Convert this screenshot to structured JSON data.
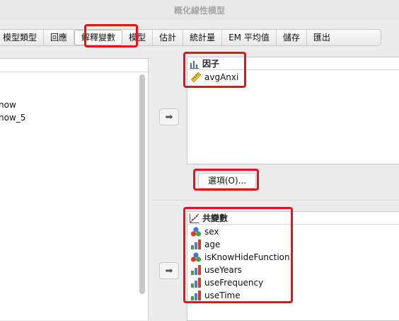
{
  "window": {
    "title": "概化線性模型"
  },
  "tabs": [
    {
      "label": "模型類型"
    },
    {
      "label": "回應"
    },
    {
      "label": "解釋變數",
      "active": true
    },
    {
      "label": "模型"
    },
    {
      "label": "估計"
    },
    {
      "label": "統計量"
    },
    {
      "label": "EM 平均值"
    },
    {
      "label": "儲存"
    },
    {
      "label": "匯出"
    }
  ],
  "variables_list": {
    "items": [
      {
        "label": "now"
      },
      {
        "label": "now_5"
      }
    ]
  },
  "factors": {
    "header": "因子",
    "icon": "factor-icon",
    "items": [
      {
        "label": "avgAnxi",
        "icon": "scale-ruler-icon"
      }
    ]
  },
  "options_button": {
    "label": "選項(O)..."
  },
  "covariates": {
    "header": "共變數",
    "icon": "covariate-icon",
    "items": [
      {
        "label": "sex",
        "icon": "nominal-icon"
      },
      {
        "label": "age",
        "icon": "ordinal-icon"
      },
      {
        "label": "isKnowHideFunction",
        "icon": "nominal-icon"
      },
      {
        "label": "useYears",
        "icon": "ordinal-icon"
      },
      {
        "label": "useFrequency",
        "icon": "ordinal-icon"
      },
      {
        "label": "useTime",
        "icon": "ordinal-icon"
      }
    ]
  },
  "colors": {
    "highlight": "#e8101a"
  }
}
